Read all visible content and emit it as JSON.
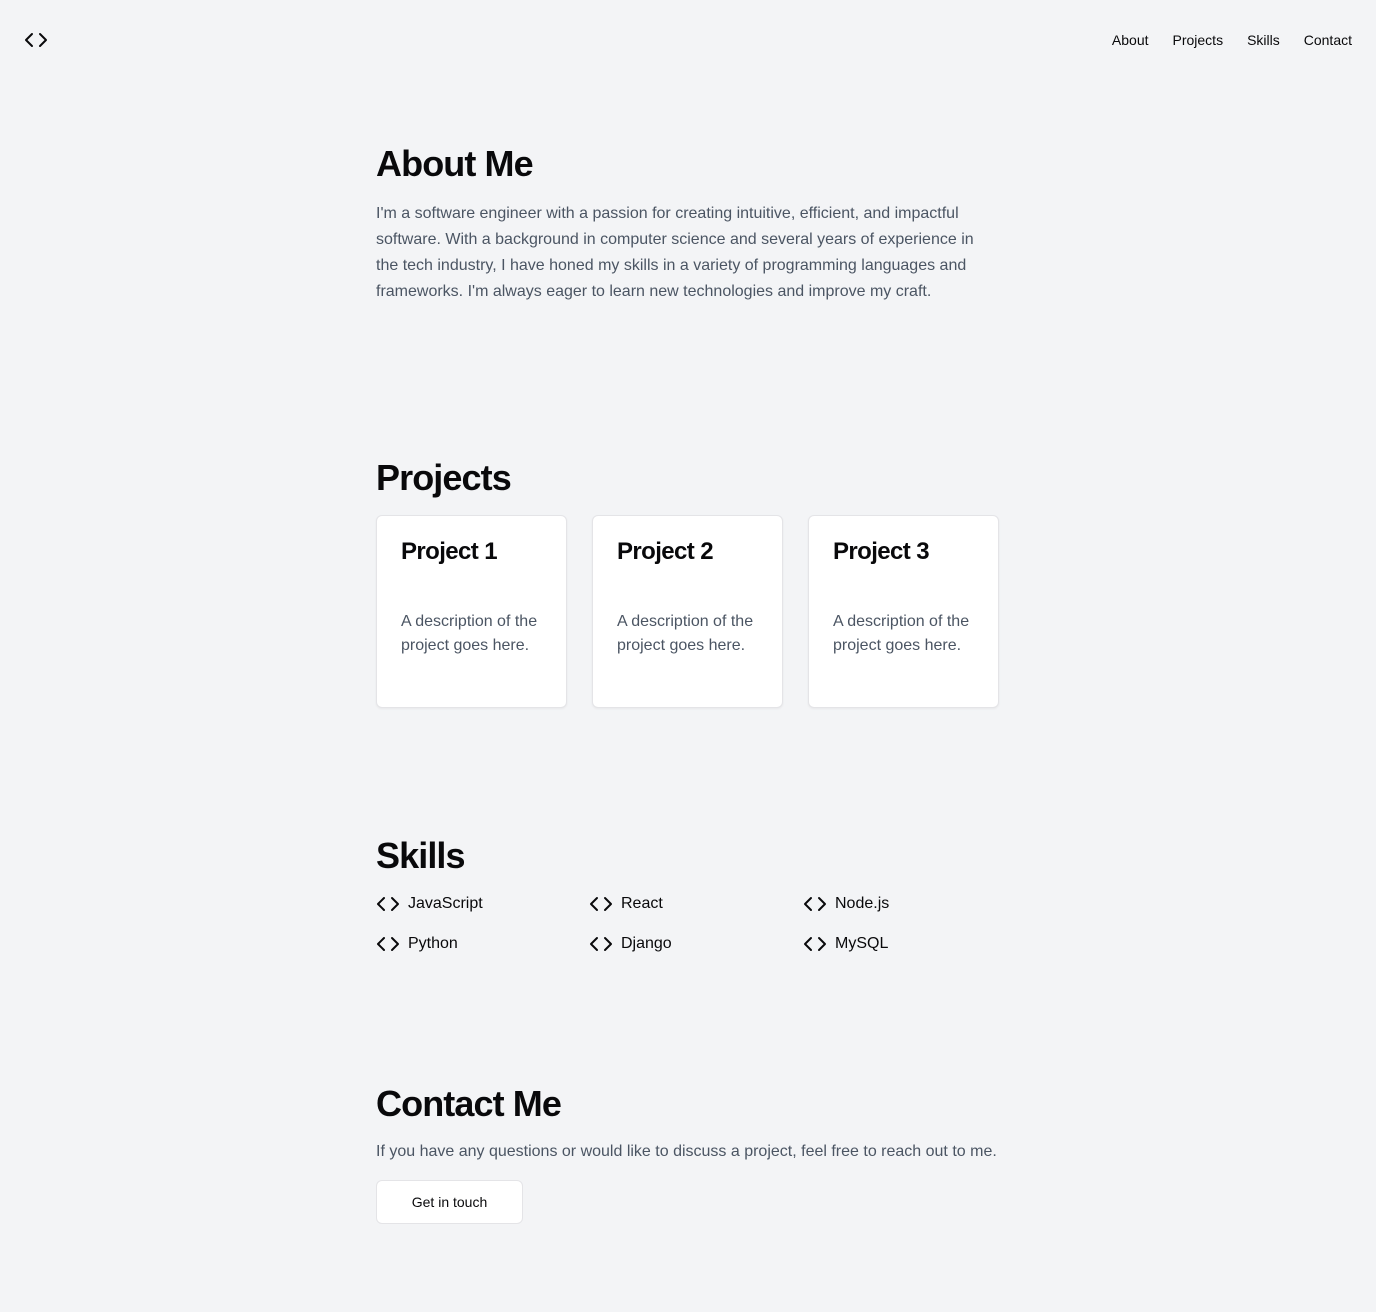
{
  "header": {
    "logo_icon": "code-icon",
    "nav": [
      {
        "label": "About"
      },
      {
        "label": "Projects"
      },
      {
        "label": "Skills"
      },
      {
        "label": "Contact"
      }
    ]
  },
  "about": {
    "title": "About Me",
    "body": "I'm a software engineer with a passion for creating intuitive, efficient, and impactful software. With a background in computer science and several years of experience in the tech industry, I have honed my skills in a variety of programming languages and frameworks. I'm always eager to learn new technologies and improve my craft."
  },
  "projects": {
    "title": "Projects",
    "items": [
      {
        "title": "Project 1",
        "description": "A description of the project goes here."
      },
      {
        "title": "Project 2",
        "description": "A description of the project goes here."
      },
      {
        "title": "Project 3",
        "description": "A description of the project goes here."
      }
    ]
  },
  "skills": {
    "title": "Skills",
    "icon": "code-icon",
    "items": [
      {
        "label": "JavaScript"
      },
      {
        "label": "React"
      },
      {
        "label": "Node.js"
      },
      {
        "label": "Python"
      },
      {
        "label": "Django"
      },
      {
        "label": "MySQL"
      }
    ]
  },
  "contact": {
    "title": "Contact Me",
    "body": "If you have any questions or would like to discuss a project, feel free to reach out to me.",
    "button_label": "Get in touch"
  },
  "colors": {
    "background": "#f3f4f6",
    "text": "#09090b",
    "muted_text": "#4b5563",
    "card_background": "#ffffff",
    "border": "#e4e4e7"
  }
}
